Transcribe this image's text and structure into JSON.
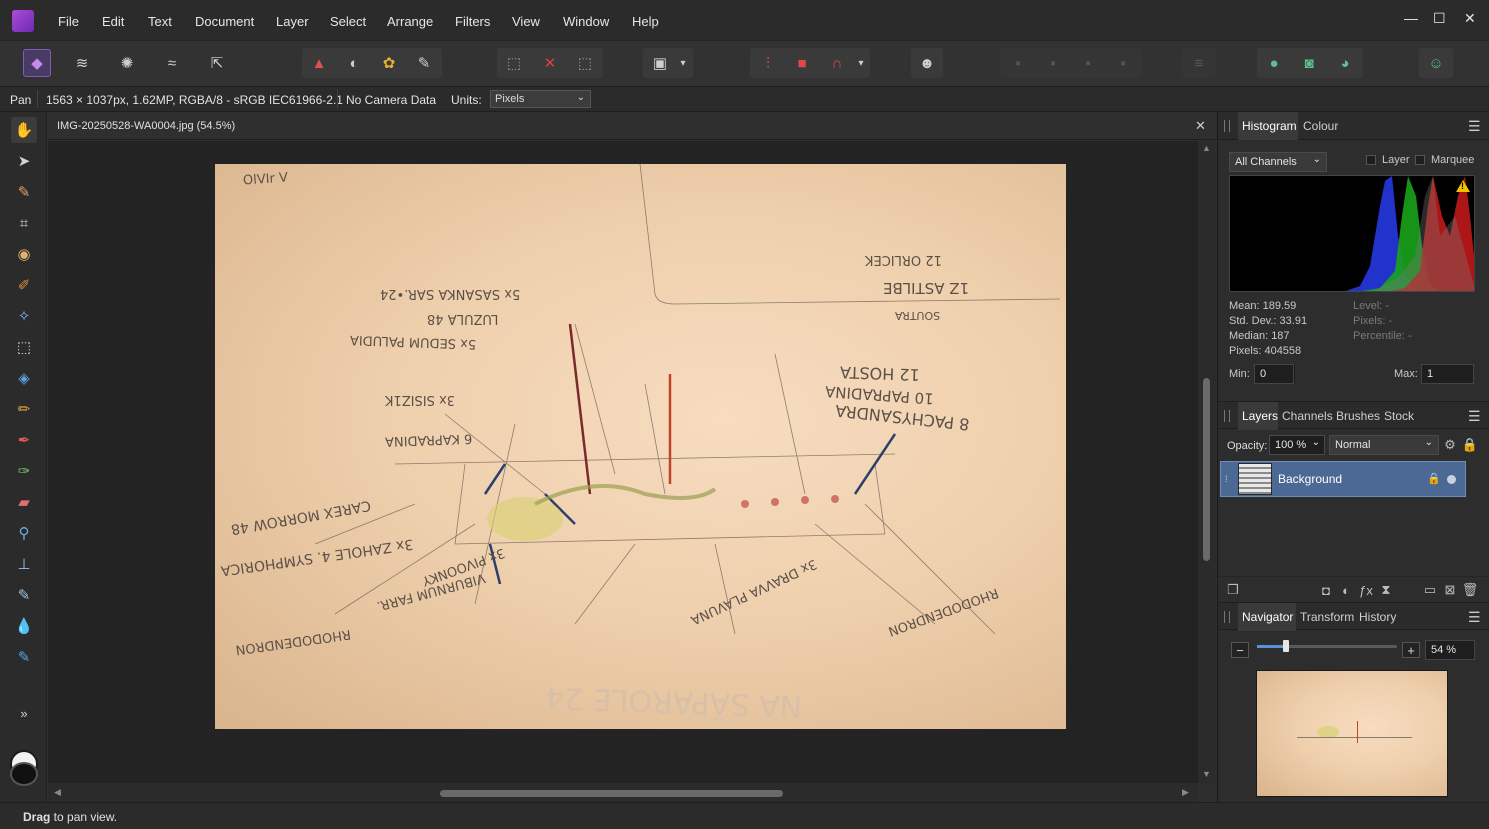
{
  "app": {
    "menus": [
      "File",
      "Edit",
      "Text",
      "Document",
      "Layer",
      "Select",
      "Arrange",
      "Filters",
      "View",
      "Window",
      "Help"
    ],
    "window_controls": {
      "minimize": "—",
      "maximize": "☐",
      "close": "✕"
    }
  },
  "context": {
    "tool": "Pan",
    "info": "1563 × 1037px, 1.62MP, RGBA/8 - sRGB IEC61966-2.1",
    "camera": "No Camera Data",
    "units_label": "Units:",
    "units_value": "Pixels"
  },
  "document": {
    "tab_title": "IMG-20250528-WA0004.jpg (54.5%)",
    "close": "✕"
  },
  "status": {
    "bold": "Drag",
    "rest": " to pan view."
  },
  "histogram": {
    "tabs": [
      "Histogram",
      "Colour"
    ],
    "channel": "All Channels",
    "layer_label": "Layer",
    "marquee_label": "Marquee",
    "stats": {
      "mean": "Mean: 189.59",
      "std": "Std. Dev.: 33.91",
      "median": "Median: 187",
      "pixels": "Pixels: 404558",
      "level": "Level: -",
      "pixels2": "Pixels: -",
      "percentile": "Percentile: -"
    },
    "min_label": "Min:",
    "min_value": "0",
    "max_label": "Max:",
    "max_value": "1",
    "warning": "!"
  },
  "layers": {
    "tabs": [
      "Layers",
      "Channels",
      "Brushes",
      "Stock"
    ],
    "opacity_label": "Opacity:",
    "opacity_value": "100 %",
    "blend": "Normal",
    "items": [
      {
        "name": "Background"
      }
    ]
  },
  "navigator": {
    "tabs": [
      "Navigator",
      "Transform",
      "History"
    ],
    "zoom": "54 %",
    "minus": "−",
    "plus": "+"
  },
  "photo_text": {
    "t1": "OlVIr V",
    "t2": "12 ORLICEK",
    "t3": "1Z ASTILBE",
    "t4": "SOUTRA",
    "t5": "5x SASANKA SAR.•24",
    "t6": "LUZULA 48",
    "t7": "5x SEDUM PALUDIA",
    "t8": "3x SISIZ1K",
    "t9": "6 KAPRADINA",
    "t10": "12 HOSTA",
    "t11": "10 PAPRADINA",
    "t12": "8 PACHYSANDRA",
    "t13": "CAREX MORROW 48",
    "t14": "3x ZAHOLE 4. SYMPHORICA",
    "t15": "VIBURNUM FARR.",
    "t16": "3x PIVOONKY",
    "t17": "3x DRAVVA PLAVUNA",
    "t18": "RHODODENDRON",
    "t19": "NA SÄPAROLE 24",
    "t20": "RHODODENDRON"
  }
}
